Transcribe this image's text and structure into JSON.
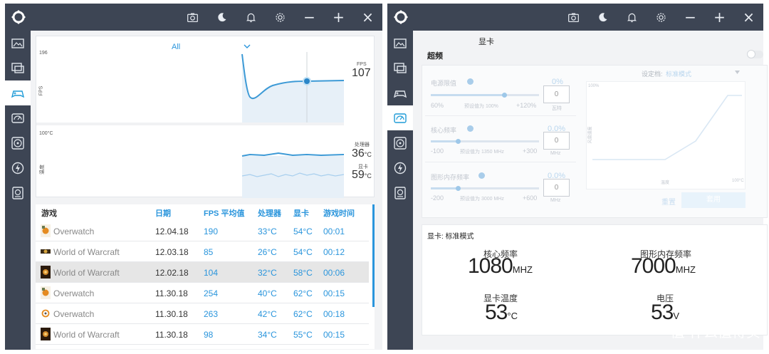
{
  "left": {
    "dropdown": "All",
    "fps_chart": {
      "ymax_label": "196",
      "ylabel": "FPS",
      "legend_label": "FPS",
      "current": "107"
    },
    "temp_chart": {
      "ymax_label": "100°C",
      "ylabel": "温度",
      "cpu_label": "处理器",
      "cpu_value": "36",
      "gpu_label": "显卡",
      "gpu_value": "59",
      "unit": "°C"
    },
    "table": {
      "headers": [
        "游戏",
        "日期",
        "FPS 平均值",
        "处理器",
        "显卡",
        "游戏时间"
      ],
      "rows": [
        {
          "game": "Overwatch",
          "date": "12.04.18",
          "fps": "190",
          "cpu": "33°C",
          "gpu": "54°C",
          "time": "00:01"
        },
        {
          "game": "World of Warcraft",
          "date": "12.03.18",
          "fps": "85",
          "cpu": "26°C",
          "gpu": "54°C",
          "time": "00:12"
        },
        {
          "game": "World of Warcraft",
          "date": "12.02.18",
          "fps": "104",
          "cpu": "32°C",
          "gpu": "58°C",
          "time": "00:06"
        },
        {
          "game": "Overwatch",
          "date": "11.30.18",
          "fps": "254",
          "cpu": "40°C",
          "gpu": "62°C",
          "time": "00:15"
        },
        {
          "game": "Overwatch",
          "date": "11.30.18",
          "fps": "263",
          "cpu": "42°C",
          "gpu": "62°C",
          "time": "00:18"
        },
        {
          "game": "World of Warcraft",
          "date": "11.30.18",
          "fps": "98",
          "cpu": "34°C",
          "gpu": "55°C",
          "time": "00:15"
        }
      ]
    }
  },
  "right": {
    "title": "显卡",
    "overclock_label": "超频",
    "power": {
      "label": "电源限值",
      "pct": "0%",
      "min": "60%",
      "default": "预设值为 100%",
      "max": "+120%",
      "value": "0",
      "unit": "瓦特",
      "level": 0.68
    },
    "core": {
      "label": "核心频率",
      "pct": "0.0%",
      "min": "-100",
      "default": "预设值为 1350 MHz",
      "max": "+300",
      "value": "0",
      "unit": "MHz",
      "level": 0.25
    },
    "mem": {
      "label": "图形内存频率",
      "pct": "0.0%",
      "min": "-200",
      "default": "预设值为 3000 MHz",
      "max": "+600",
      "value": "0",
      "unit": "MHz",
      "level": 0.25
    },
    "profile": {
      "label": "设定档:",
      "value": "标准模式"
    },
    "fan": {
      "ymax": "100%",
      "ylabel": "风扇速度",
      "xlabel": "温度",
      "xmax": "100°C"
    },
    "btn_reset": "重置",
    "btn_apply": "套用",
    "status": {
      "title": "显卡: 标准模式",
      "core_label": "核心频率",
      "core_value": "1080",
      "core_unit": "MHZ",
      "mem_label": "图形内存频率",
      "mem_value": "7000",
      "mem_unit": "MHZ",
      "temp_label": "显卡温度",
      "temp_value": "53",
      "temp_unit": "°C",
      "volt_label": "电压",
      "volt_value": "53",
      "volt_unit": "V"
    }
  },
  "watermark": "值 什么值得买",
  "colors": {
    "accent": "#2a95dc",
    "sidebar": "#3d4554",
    "selected_row": "#e6e6e6"
  }
}
